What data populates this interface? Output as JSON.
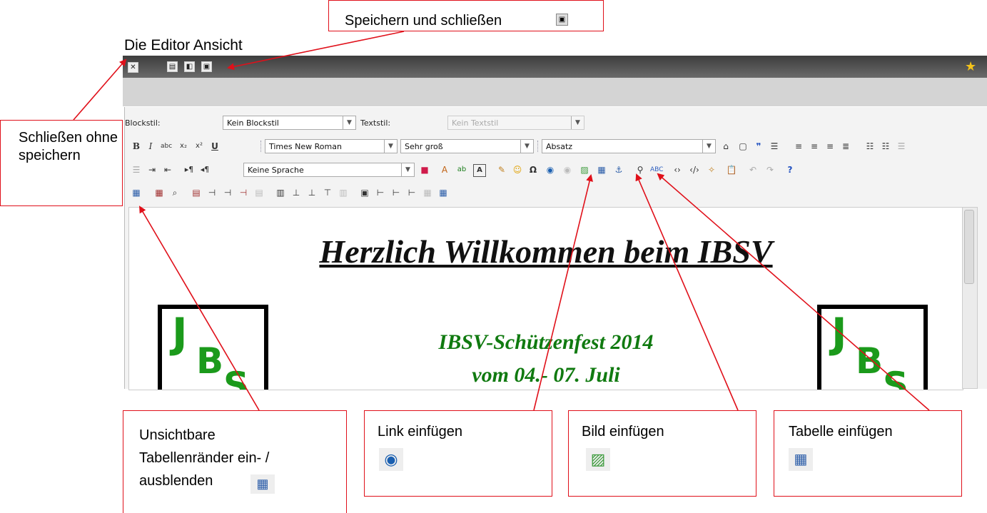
{
  "caption": "Die Editor Ansicht",
  "callouts": {
    "save_close": "Speichern und schließen",
    "close_no_save": "Schließen ohne speichern",
    "toggle_borders": "Unsichtbare Tabellenränder ein- / ausblenden",
    "link": "Link einfügen",
    "image": "Bild einfügen",
    "table": "Tabelle einfügen"
  },
  "toolbar": {
    "blockstil_label": "Blockstil:",
    "blockstil_value": "Kein Blockstil",
    "textstil_label": "Textstil:",
    "textstil_value": "Kein Textstil",
    "font_value": "Times New Roman",
    "size_value": "Sehr groß",
    "format_value": "Absatz",
    "language_value": "Keine Sprache"
  },
  "document": {
    "heading": "Herzlich Willkommen beim IBSV",
    "event_line1": "IBSV-Schützenfest 2014",
    "event_line2": "vom 04.- 07. Juli"
  },
  "icons": {
    "close": "close-icon",
    "save": "save-icon",
    "preview": "preview-icon",
    "save_close": "save-close-icon",
    "favorite": "star-add-icon",
    "link": "link-globe-icon",
    "image": "image-icon",
    "table": "table-icon"
  },
  "colors": {
    "callout_border": "#e0101a",
    "event_text": "#107a10"
  }
}
